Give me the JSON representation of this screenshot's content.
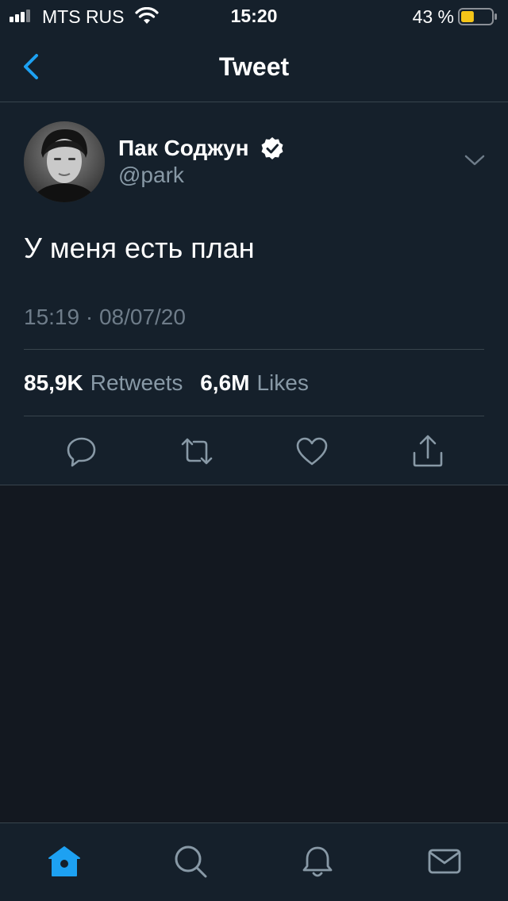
{
  "status_bar": {
    "carrier": "MTS RUS",
    "time": "15:20",
    "battery_percent": "43 %",
    "battery_level": 0.43,
    "battery_color": "#f5c518",
    "icons": [
      "cellular-signal-icon",
      "wifi-icon",
      "battery-icon"
    ]
  },
  "nav": {
    "title": "Tweet",
    "back_icon": "chevron-left-icon"
  },
  "tweet": {
    "author_name": "Пак Соджун",
    "verified": true,
    "handle": "@park",
    "text": "У меня есть план",
    "timestamp": "15:19 · 08/07/20",
    "retweets_count": "85,9K",
    "retweets_label": "Retweets",
    "likes_count": "6,6M",
    "likes_label": "Likes",
    "actions": [
      "reply-icon",
      "retweet-icon",
      "like-icon",
      "share-icon"
    ]
  },
  "tab_bar": {
    "tabs": [
      "home-icon",
      "search-icon",
      "notifications-icon",
      "messages-icon"
    ],
    "active_tab": "home-icon"
  },
  "colors": {
    "accent": "#1da1f2",
    "background": "#15202b",
    "empty_area": "#131820",
    "secondary_text": "#8899a6",
    "divider": "#38444d"
  }
}
